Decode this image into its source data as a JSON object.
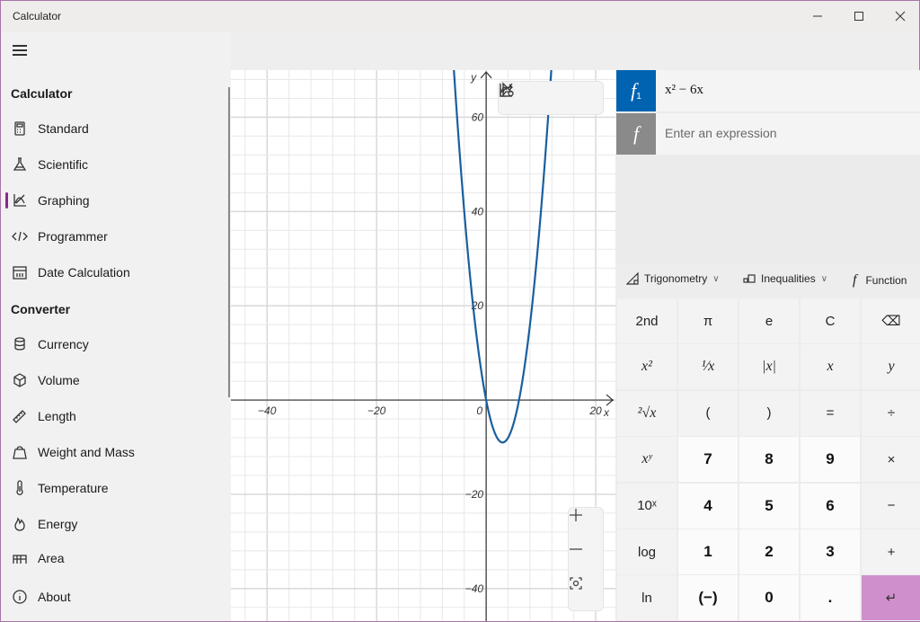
{
  "window": {
    "title": "Calculator",
    "controls": {
      "minimize": "minimize",
      "maximize": "maximize",
      "close": "close"
    }
  },
  "sidebar": {
    "menu_icon": "hamburger-icon",
    "calculator_heading": "Calculator",
    "calculator_items": [
      {
        "label": "Standard",
        "icon": "calculator-icon"
      },
      {
        "label": "Scientific",
        "icon": "flask-icon"
      },
      {
        "label": "Graphing",
        "icon": "graph-icon",
        "selected": true
      },
      {
        "label": "Programmer",
        "icon": "code-icon"
      },
      {
        "label": "Date Calculation",
        "icon": "calendar-icon"
      }
    ],
    "converter_heading": "Converter",
    "converter_items": [
      {
        "label": "Currency",
        "icon": "coins-icon"
      },
      {
        "label": "Volume",
        "icon": "cube-icon"
      },
      {
        "label": "Length",
        "icon": "ruler-icon"
      },
      {
        "label": "Weight and Mass",
        "icon": "weight-icon"
      },
      {
        "label": "Temperature",
        "icon": "thermometer-icon"
      },
      {
        "label": "Energy",
        "icon": "flame-icon"
      },
      {
        "label": "Area",
        "icon": "area-icon"
      }
    ],
    "about": {
      "label": "About",
      "icon": "info-icon"
    },
    "accent": "#8a2a8c"
  },
  "graph": {
    "toolbar": [
      "select-icon",
      "share-icon",
      "graph-settings-icon"
    ],
    "zoom_controls": [
      "zoom-in",
      "zoom-out",
      "reset-view"
    ],
    "chart_data": {
      "type": "line",
      "title": "",
      "xlabel": "x",
      "ylabel": "y",
      "xlim": [
        -46.6,
        23.6
      ],
      "ylim": [
        -46.9,
        70
      ],
      "x_ticks": [
        -40,
        -20,
        0,
        20
      ],
      "y_ticks": [
        60,
        40,
        20,
        -20,
        -40
      ],
      "x_tick_labels": [
        "−40",
        "−20",
        "0",
        "20"
      ],
      "y_tick_labels": [
        "60",
        "40",
        "20",
        "−20",
        "−40"
      ],
      "grid": true,
      "minor_step": 4,
      "series": [
        {
          "name": "f1",
          "expression": "x^2 - 6x",
          "color": "#1a5f9e",
          "coef": [
            1,
            -6,
            0
          ]
        }
      ]
    }
  },
  "functions": {
    "items": [
      {
        "badge": "f",
        "sub": "1",
        "expression": "x² − 6x",
        "color": "#0063b1"
      }
    ],
    "new_badge": "f",
    "placeholder": "Enter an expression",
    "new_badge_color": "#8a8a8a"
  },
  "keypad": {
    "dropdowns": [
      {
        "label": "Trigonometry",
        "icon": "triangle-icon"
      },
      {
        "label": "Inequalities",
        "icon": "inequality-icon"
      },
      {
        "label": "Function",
        "icon": "function-icon"
      }
    ],
    "rows": [
      [
        "2nd",
        "π",
        "e",
        "C",
        "⌫"
      ],
      [
        "x²",
        "¹⁄x",
        "|x|",
        "x",
        "y"
      ],
      [
        "²√x",
        "(",
        ")",
        "=",
        "÷"
      ],
      [
        "xʸ",
        "7",
        "8",
        "9",
        "×"
      ],
      [
        "10ˣ",
        "4",
        "5",
        "6",
        "−"
      ],
      [
        "log",
        "1",
        "2",
        "3",
        "+"
      ],
      [
        "ln",
        "(−)",
        "0",
        ".",
        "↵"
      ]
    ],
    "enter_color": "#cf8fcc"
  }
}
